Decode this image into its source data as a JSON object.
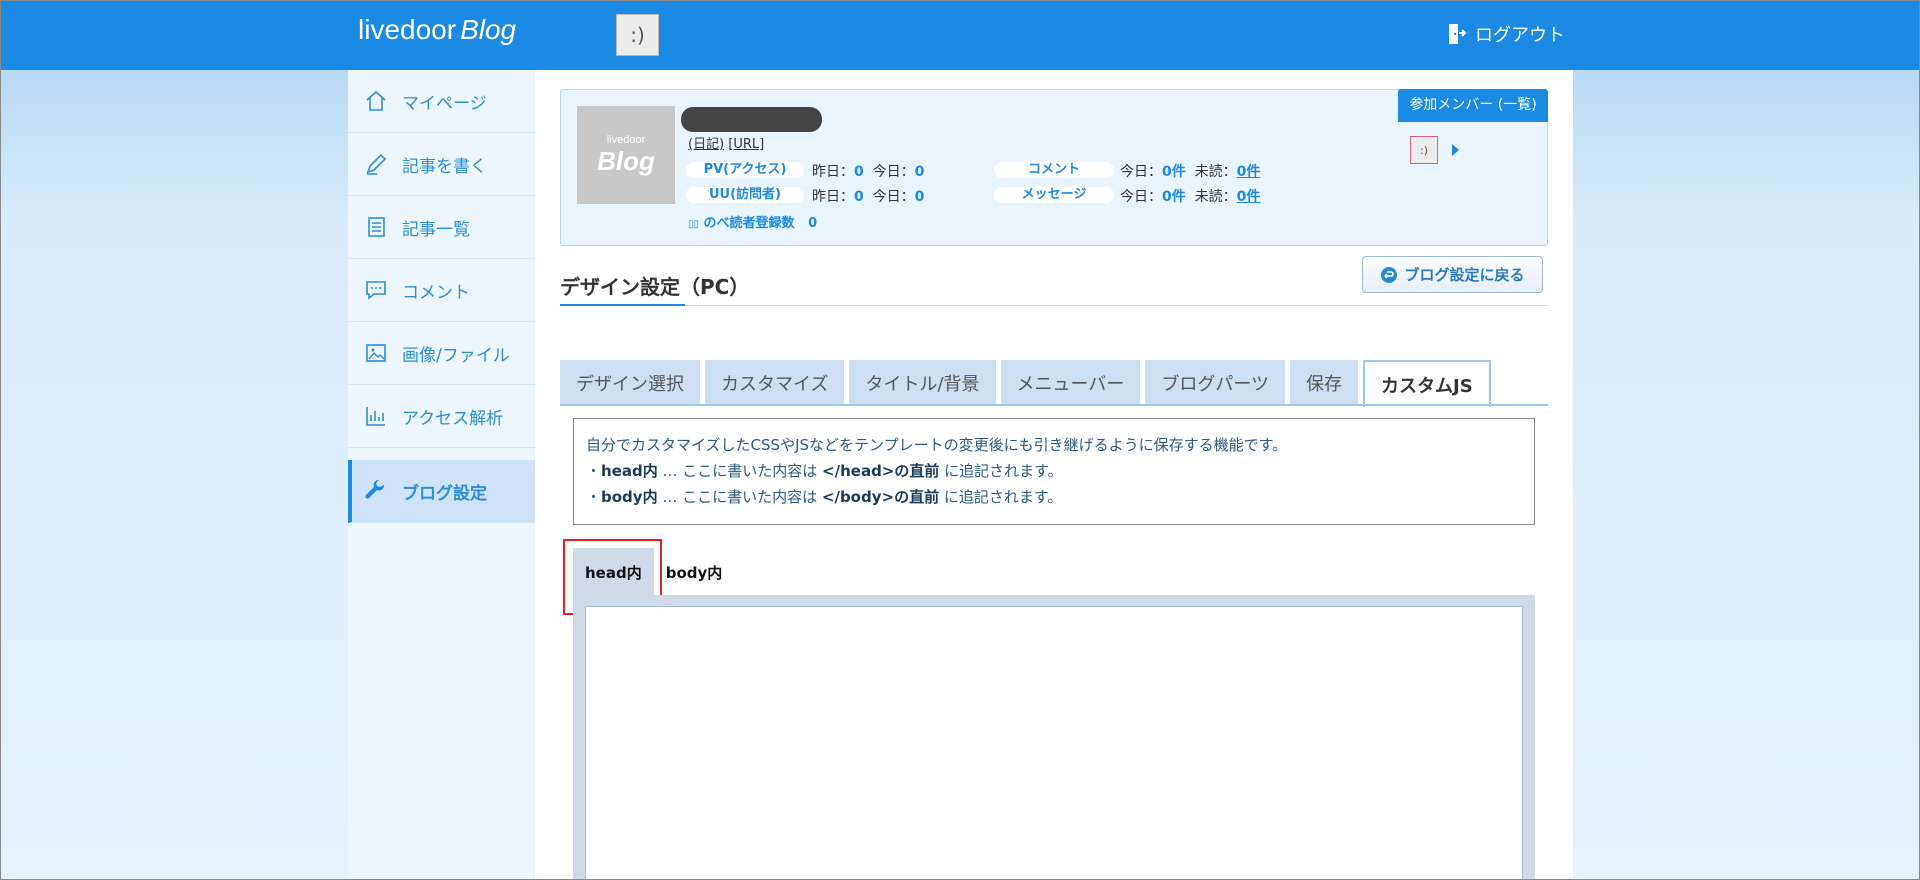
{
  "header": {
    "logo_part1": "livedoor",
    "logo_part2": "Blog",
    "logout_label": "ログアウト",
    "avatar_glyph": ":)"
  },
  "sidebar": {
    "items": [
      {
        "label": "マイページ",
        "icon": "home-icon"
      },
      {
        "label": "記事を書く",
        "icon": "pen-icon"
      },
      {
        "label": "記事一覧",
        "icon": "list-icon"
      },
      {
        "label": "コメント",
        "icon": "comment-icon"
      },
      {
        "label": "画像/ファイル",
        "icon": "image-icon"
      },
      {
        "label": "アクセス解析",
        "icon": "chart-icon"
      },
      {
        "label": "ブログ設定",
        "icon": "wrench-icon",
        "active": true
      }
    ]
  },
  "profile": {
    "thumb_small": "livedoor",
    "thumb_large": "Blog",
    "link_diary": "(日記)",
    "link_url": "[URL]",
    "pv_label": "PV(アクセス)",
    "uu_label": "UU(訪問者)",
    "yesterday_label": "昨日：",
    "today_label": "今日：",
    "pv_yesterday": "0",
    "pv_today": "0",
    "uu_yesterday": "0",
    "uu_today": "0",
    "comment_label": "コメント",
    "message_label": "メッセージ",
    "comment_today": "0件",
    "comment_unread": "0件",
    "message_today": "0件",
    "message_unread": "0件",
    "unread_label": "未読：",
    "readers_label": "のべ読者登録数",
    "readers_count": "0",
    "members_button": "参加メンバー (一覧)"
  },
  "back_button": "ブログ設定に戻る",
  "section_title": "デザイン設定（PC）",
  "tabs": [
    {
      "label": "デザイン選択"
    },
    {
      "label": "カスタマイズ"
    },
    {
      "label": "タイトル/背景"
    },
    {
      "label": "メニューバー"
    },
    {
      "label": "ブログパーツ"
    },
    {
      "label": "保存"
    },
    {
      "label": "カスタムJS",
      "active": true
    }
  ],
  "description": {
    "line1": "自分でカスタマイズしたCSSやJSなどをテンプレートの変更後にも引き継げるように保存する機能です。",
    "head_bullet": "・",
    "head_term": "head内",
    "head_mid": " … ここに書いた内容は ",
    "head_target": "</head>の直前",
    "head_end": " に追記されます。",
    "body_bullet": "・",
    "body_term": "body内",
    "body_mid": " … ここに書いた内容は ",
    "body_target": "</body>の直前",
    "body_end": " に追記されます。"
  },
  "subtabs": [
    {
      "label": "head内",
      "active": true
    },
    {
      "label": "body内"
    }
  ],
  "editor_value": ""
}
